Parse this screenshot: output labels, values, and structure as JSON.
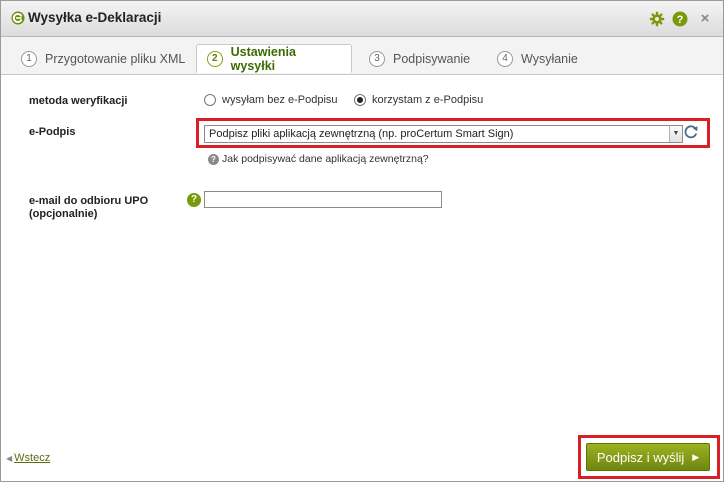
{
  "window": {
    "title": "Wysyłka e-Deklaracji",
    "icons": [
      "app-logo-icon",
      "gear-icon",
      "help-icon",
      "close-icon"
    ],
    "close_glyph": "×",
    "help_glyph": "?"
  },
  "tabs": [
    {
      "num": "1",
      "label": "Przygotowanie pliku XML",
      "active": false
    },
    {
      "num": "2",
      "label": "Ustawienia wysyłki",
      "active": true
    },
    {
      "num": "3",
      "label": "Podpisywanie",
      "active": false
    },
    {
      "num": "4",
      "label": "Wysyłanie",
      "active": false
    }
  ],
  "form": {
    "method": {
      "label": "metoda weryfikacji",
      "option_without": "wysyłam bez e-Podpisu",
      "option_with": "korzystam z e-Podpisu",
      "selected": "korzystam z e-Podpisu"
    },
    "signature": {
      "label": "e-Podpis",
      "selected_value": "Podpisz pliki aplikacją zewnętrzną (np. proCertum Smart Sign)",
      "help_text": "Jak podpisywać dane aplikacją zewnętrzną?"
    },
    "upo": {
      "label_line1": "e-mail do odbioru UPO",
      "label_line2": "(opcjonalnie)",
      "help_glyph": "?",
      "value": ""
    }
  },
  "footer": {
    "back_label": "Wstecz",
    "submit_label": "Podpisz i wyślij"
  },
  "colors": {
    "accent_green": "#7a9a0c",
    "highlight_red": "#d71f25",
    "active_tab_text": "#3d6b00"
  }
}
